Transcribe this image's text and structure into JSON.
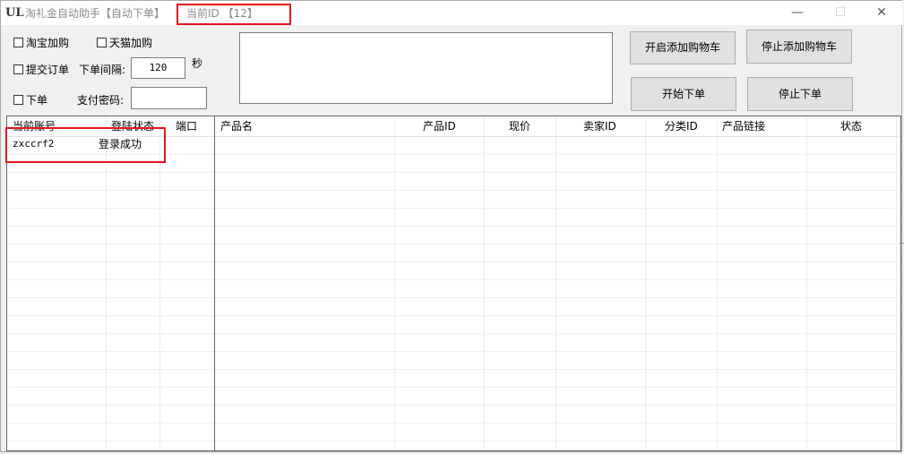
{
  "titlebar": {
    "title": "淘礼金自动助手【自动下单】",
    "current_id": "当前ID 【12】",
    "minimize": "—",
    "maximize": "☐",
    "close": "✕"
  },
  "options": {
    "taobao_add": "淘宝加购",
    "tmall_add": "天猫加购",
    "submit_order": "提交订单",
    "interval_label": "下单间隔:",
    "interval_value": "120",
    "interval_unit": "秒",
    "place_order": "下单",
    "pay_password_label": "支付密码:",
    "pay_password_value": ""
  },
  "buttons": {
    "start_add_cart": "开启添加购物车",
    "stop_add_cart": "停止添加购物车",
    "start_order": "开始下单",
    "stop_order": "停止下单"
  },
  "accounts_table": {
    "columns": [
      "当前账号",
      "登陆状态",
      "端口"
    ],
    "rows": [
      {
        "account": "zxccrf2",
        "status": "登录成功",
        "port": ""
      }
    ]
  },
  "products_table": {
    "columns": [
      "产品名",
      "产品ID",
      "现价",
      "卖家ID",
      "分类ID",
      "产品链接",
      "状态"
    ],
    "rows": []
  }
}
